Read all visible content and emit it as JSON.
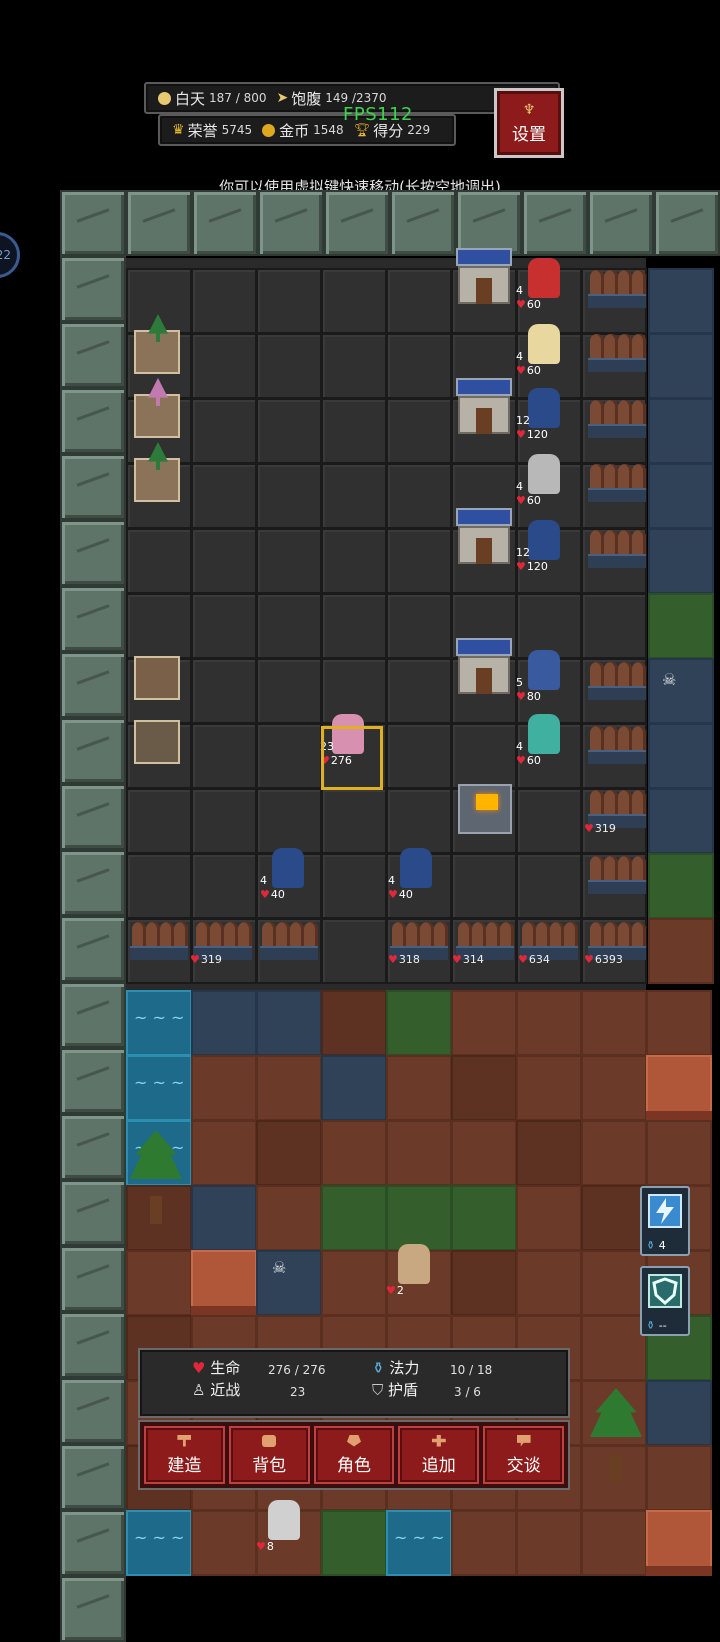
{
  "hud": {
    "day_label": "白天",
    "day_value": "187 / 800",
    "satiety_label": "饱腹",
    "satiety_value": "149 /2370",
    "honor_label": "荣誉",
    "honor_value": "5745",
    "gold_label": "金币",
    "gold_value": "1548",
    "score_label": "得分",
    "score_value": "229",
    "fps": "FPS112",
    "settings_label": "设置"
  },
  "hint": "你可以使用虚拟键快速移动(长按空地调出)",
  "side_badge": "22",
  "units": [
    {
      "kind": "red-hood",
      "level": "4",
      "hp": "60"
    },
    {
      "kind": "angel",
      "level": "4",
      "hp": "60"
    },
    {
      "kind": "crossbow-knight",
      "level": "12",
      "hp": "120"
    },
    {
      "kind": "axe-warrior",
      "level": "4",
      "hp": "60"
    },
    {
      "kind": "crossbow-knight",
      "level": "12",
      "hp": "120"
    },
    {
      "kind": "horned-knight",
      "level": "5",
      "hp": "80"
    },
    {
      "kind": "teal-fighter",
      "level": "4",
      "hp": "60"
    },
    {
      "kind": "hero",
      "level": "23",
      "hp": "276"
    },
    {
      "kind": "crossbow-knight",
      "level": "4",
      "hp": "40"
    },
    {
      "kind": "crossbow-knight",
      "level": "4",
      "hp": "40"
    },
    {
      "kind": "rooster",
      "level": "",
      "hp": "2"
    },
    {
      "kind": "skeleton",
      "level": "",
      "hp": "8"
    }
  ],
  "wall_hp": [
    "319",
    "319",
    "318",
    "314",
    "634",
    "6393"
  ],
  "skills": [
    {
      "icon": "lightning-icon",
      "count": "4"
    },
    {
      "icon": "shield-skill-icon",
      "count": "--"
    }
  ],
  "stats": {
    "life_label": "生命",
    "life_value": "276 / 276",
    "mana_label": "法力",
    "mana_value": "10 / 18",
    "melee_label": "近战",
    "melee_value": "23",
    "shield_label": "护盾",
    "shield_value": "3 / 6"
  },
  "actions": [
    {
      "label": "建造",
      "icon": "hammer-icon"
    },
    {
      "label": "背包",
      "icon": "bag-icon"
    },
    {
      "label": "角色",
      "icon": "character-icon"
    },
    {
      "label": "追加",
      "icon": "plus-icon"
    },
    {
      "label": "交谈",
      "icon": "talk-icon"
    }
  ],
  "colors": {
    "accent_red": "#8e1b1b",
    "gold": "#e0b020",
    "fps_green": "#3bd34a",
    "heart": "#e0283a"
  }
}
